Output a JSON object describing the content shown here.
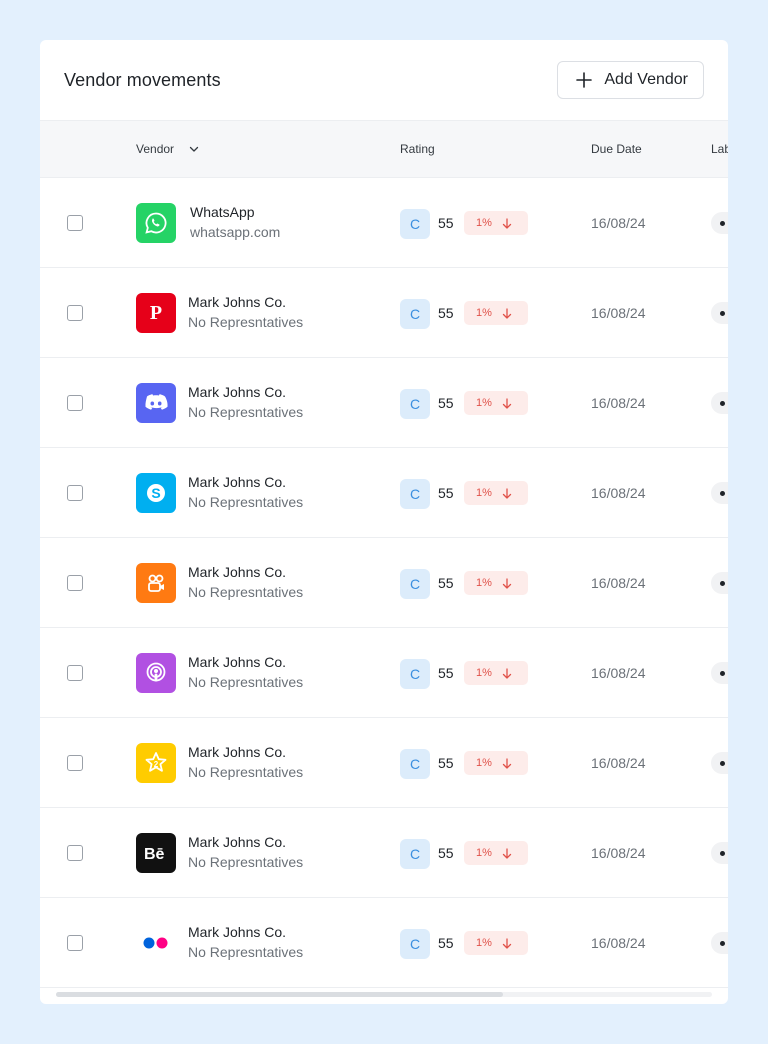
{
  "colors": {
    "page_bg": "#e3f0fd",
    "card_bg": "#ffffff",
    "grade_bg": "#dcecfb",
    "delta_bg": "#fdecea",
    "delta_fg": "#e0524a"
  },
  "header": {
    "title": "Vendor movements",
    "add_button_label": "Add Vendor",
    "add_icon": "plus-icon"
  },
  "table": {
    "columns": {
      "vendor": "Vendor",
      "rating": "Rating",
      "due": "Due Date",
      "label": "Lab"
    },
    "rows": [
      {
        "logo": "whatsapp-logo",
        "logo_color": "#25d366",
        "name": "WhatsApp",
        "sub": "whatsapp.com",
        "grade": "C",
        "score": "55",
        "delta": "1%",
        "due": "16/08/24"
      },
      {
        "logo": "pinterest-logo",
        "logo_color": "#e60019",
        "name": "Mark Johns Co.",
        "sub": "No Represntatives",
        "grade": "C",
        "score": "55",
        "delta": "1%",
        "due": "16/08/24"
      },
      {
        "logo": "discord-logo",
        "logo_color": "#5865f2",
        "name": "Mark Johns Co.",
        "sub": "No Represntatives",
        "grade": "C",
        "score": "55",
        "delta": "1%",
        "due": "16/08/24"
      },
      {
        "logo": "skype-logo",
        "logo_color": "#00aff0",
        "name": "Mark Johns Co.",
        "sub": "No Represntatives",
        "grade": "C",
        "score": "55",
        "delta": "1%",
        "due": "16/08/24"
      },
      {
        "logo": "kuaishou-logo",
        "logo_color": "#ff7a12",
        "name": "Mark Johns Co.",
        "sub": "No Represntatives",
        "grade": "C",
        "score": "55",
        "delta": "1%",
        "due": "16/08/24"
      },
      {
        "logo": "podcasts-logo",
        "logo_color": "#b150e2",
        "name": "Mark Johns Co.",
        "sub": "No Represntatives",
        "grade": "C",
        "score": "55",
        "delta": "1%",
        "due": "16/08/24"
      },
      {
        "logo": "star-app-logo",
        "logo_color": "#ffcc00",
        "name": "Mark Johns Co.",
        "sub": "No Represntatives",
        "grade": "C",
        "score": "55",
        "delta": "1%",
        "due": "16/08/24"
      },
      {
        "logo": "behance-logo",
        "logo_color": "#111111",
        "name": "Mark Johns Co.",
        "sub": "No Represntatives",
        "grade": "C",
        "score": "55",
        "delta": "1%",
        "due": "16/08/24"
      },
      {
        "logo": "flickr-logo",
        "logo_color": "#ffffff",
        "name": "Mark Johns Co.",
        "sub": "No Represntatives",
        "grade": "C",
        "score": "55",
        "delta": "1%",
        "due": "16/08/24"
      }
    ]
  }
}
